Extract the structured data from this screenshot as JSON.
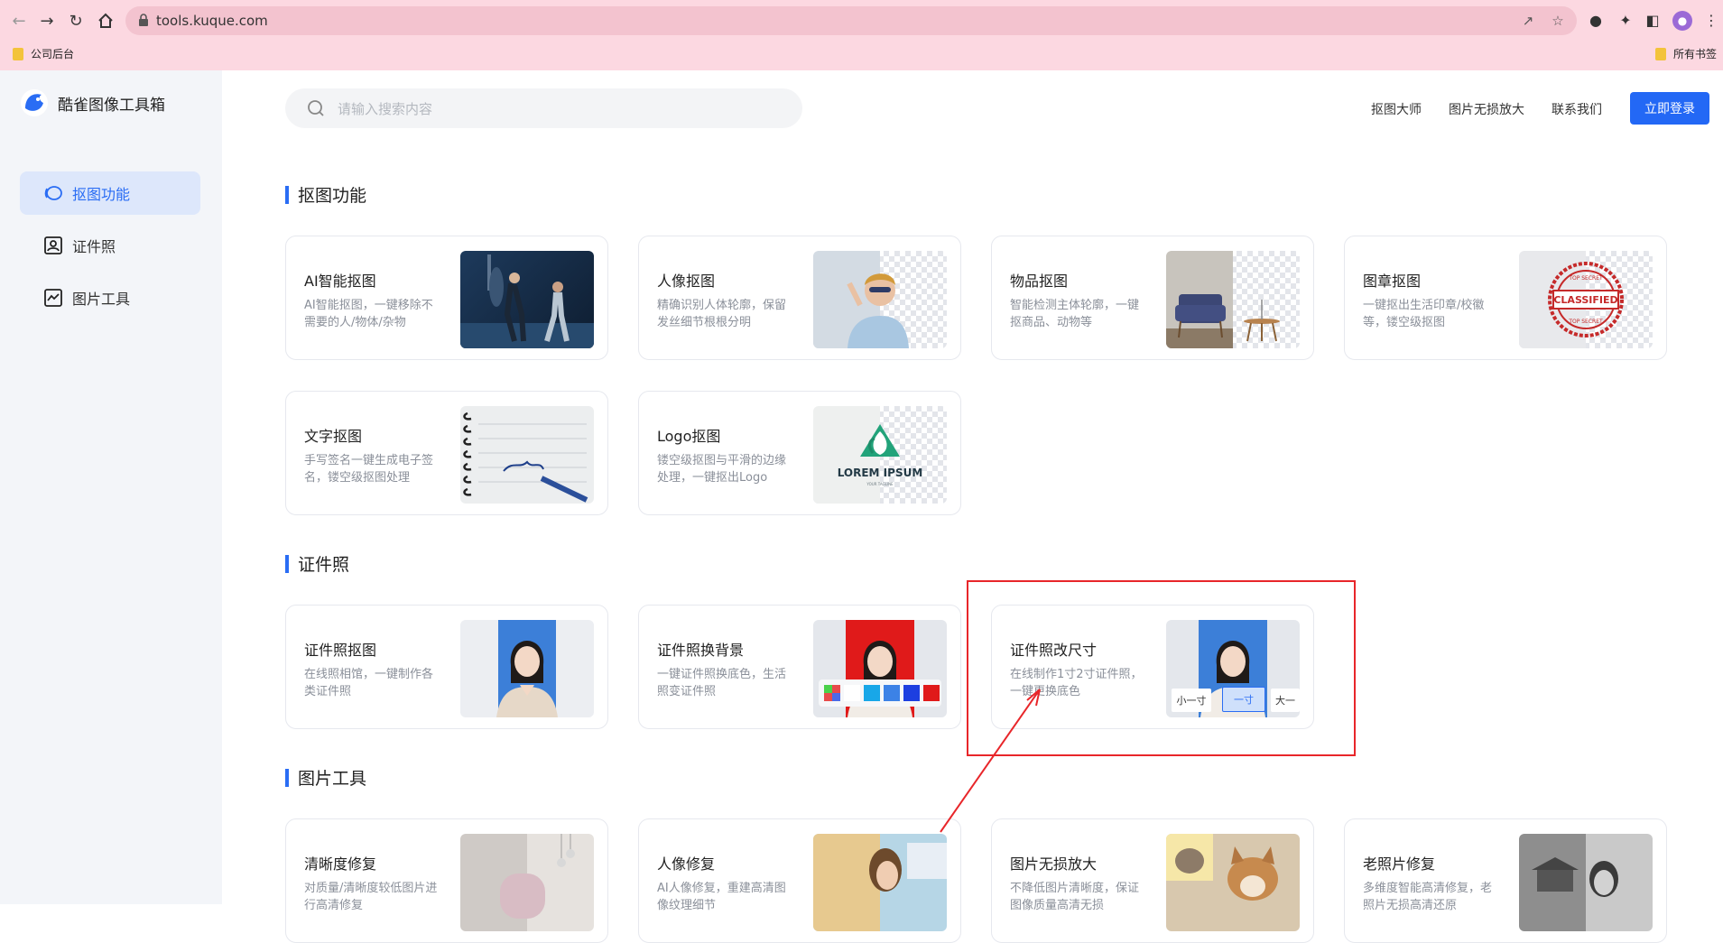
{
  "browser": {
    "url": "tools.kuque.com",
    "bookmarks": {
      "left": "公司后台",
      "right": "所有书签"
    }
  },
  "sidebar": {
    "app_name": "酷雀图像工具箱",
    "items": [
      {
        "label": "抠图功能",
        "icon": "cutout-icon",
        "active": true
      },
      {
        "label": "证件照",
        "icon": "id-photo-icon",
        "active": false
      },
      {
        "label": "图片工具",
        "icon": "image-tool-icon",
        "active": false
      }
    ]
  },
  "header": {
    "search_placeholder": "请输入搜索内容",
    "nav": [
      "抠图大师",
      "图片无损放大",
      "联系我们"
    ],
    "login_label": "立即登录"
  },
  "sections": [
    {
      "title": "抠图功能",
      "cards": [
        {
          "title": "AI智能抠图",
          "desc": "AI智能抠图，一键移除不需要的人/物体/杂物"
        },
        {
          "title": "人像抠图",
          "desc": "精确识别人体轮廓，保留发丝细节根根分明"
        },
        {
          "title": "物品抠图",
          "desc": "智能检测主体轮廓，一键抠商品、动物等"
        },
        {
          "title": "图章抠图",
          "desc": "一键抠出生活印章/校徽等，镂空级抠图"
        },
        {
          "title": "文字抠图",
          "desc": "手写签名一键生成电子签名，镂空级抠图处理"
        },
        {
          "title": "Logo抠图",
          "desc": "镂空级抠图与平滑的边缘处理，一键抠出Logo"
        }
      ]
    },
    {
      "title": "证件照",
      "cards": [
        {
          "title": "证件照抠图",
          "desc": "在线照相馆，一键制作各类证件照"
        },
        {
          "title": "证件照换背景",
          "desc": "一键证件照换底色，生活照变证件照"
        },
        {
          "title": "证件照改尺寸",
          "desc": "在线制作1寸2寸证件照，一键更换底色"
        }
      ]
    },
    {
      "title": "图片工具",
      "cards": [
        {
          "title": "清晰度修复",
          "desc": "对质量/清晰度较低图片进行高清修复"
        },
        {
          "title": "人像修复",
          "desc": "AI人像修复，重建高清图像纹理细节"
        },
        {
          "title": "图片无损放大",
          "desc": "不降低图片清晰度，保证图像质量高清无损"
        },
        {
          "title": "老照片修复",
          "desc": "多维度智能高清修复，老照片无损高清还原"
        }
      ]
    }
  ],
  "thumb_labels": {
    "stamp_top": "TOP SECRET",
    "stamp_main": "CLASSIFIED",
    "stamp_bottom": "TOP SECRET",
    "logo_main": "LOREM IPSUM",
    "logo_sub": "YOUR TAGLINE",
    "sizes": [
      "小一寸",
      "一寸",
      "大一"
    ]
  },
  "colors": {
    "accent": "#2368f5",
    "sidebar_bg": "#f3f5f9",
    "browser_bar": "#fcd8e1",
    "annotation": "#e8262a"
  }
}
